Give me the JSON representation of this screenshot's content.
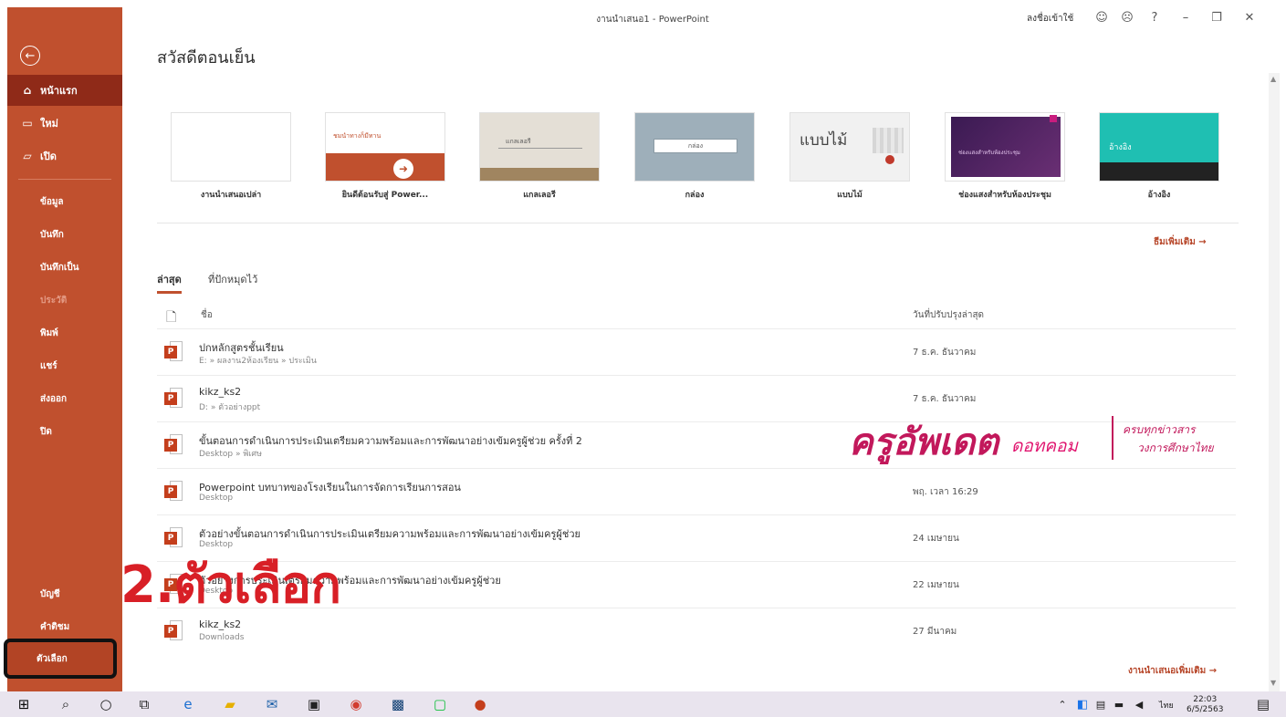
{
  "window": {
    "title": "งานนำเสนอ1 - PowerPoint",
    "signin_label": "ลงชื่อเข้าใช้"
  },
  "sidebar": {
    "back_icon": "back-arrow-icon",
    "items": [
      {
        "label": "หน้าแรก",
        "icon": "home-icon"
      },
      {
        "label": "ใหม่",
        "icon": "new-file-icon"
      },
      {
        "label": "เปิด",
        "icon": "open-folder-icon"
      }
    ],
    "sub_items": [
      "ข้อมูล",
      "บันทึก",
      "บันทึกเป็น",
      "ประวัติ",
      "พิมพ์",
      "แชร์",
      "ส่งออก",
      "ปิด"
    ],
    "bottom_items": [
      "บัญชี",
      "คำติชม",
      "ตัวเลือก"
    ]
  },
  "main": {
    "greeting": "สวัสดีตอนเย็น",
    "templates": [
      {
        "label": "งานนำเสนอเปล่า",
        "thumb_text": ""
      },
      {
        "label": "ยินดีต้อนรับสู่ Power...",
        "thumb_text": "ชมนำทางก็มีทาน"
      },
      {
        "label": "แกลเลอรี",
        "thumb_text": "แกลเลอรี"
      },
      {
        "label": "กล่อง",
        "thumb_text": "กล่อง"
      },
      {
        "label": "แบบไม้",
        "thumb_text": "แบบไม้"
      },
      {
        "label": "ช่องแสงสำหรับห้องประชุม",
        "thumb_text": "ช่องแสงสำหรับห้องประชุม"
      },
      {
        "label": "อ้างอิง",
        "thumb_text": "อ้างอิง"
      }
    ],
    "more_themes": "ธีมเพิ่มเติม →",
    "tabs": [
      "ล่าสุด",
      "ที่ปักหมุดไว้"
    ],
    "file_header": {
      "name": "ชื่อ",
      "date": "วันที่ปรับปรุงล่าสุด"
    },
    "files": [
      {
        "name": "ปกหลักสูตรชั้นเรียน",
        "path": "E: » ผลงาน2ห้องเรียน » ประเมิน",
        "date": "7 ธ.ค. ธันวาคม"
      },
      {
        "name": "kikz_ks2",
        "path": "D: » ตัวอย่างppt",
        "date": "7 ธ.ค. ธันวาคม"
      },
      {
        "name": "ขั้นตอนการดำเนินการประเมินเตรียมความพร้อมและการพัฒนาอย่างเข้มครูผู้ช่วย ครั้งที่ 2",
        "path": "Desktop » พิเศษ",
        "date": ""
      },
      {
        "name": "Powerpoint บทบาทของโรงเรียนในการจัดการเรียนการสอน",
        "path": "Desktop",
        "date": "พฤ. เวลา 16:29"
      },
      {
        "name": "ตัวอย่างขั้นตอนการดำเนินการประเมินเตรียมความพร้อมและการพัฒนาอย่างเข้มครูผู้ช่วย",
        "path": "Desktop",
        "date": "24 เมษายน"
      },
      {
        "name": "ตัวอย่างการประเมินเตรียมความพร้อมและการพัฒนาอย่างเข้มครูผู้ช่วย",
        "path": "Desktop",
        "date": "22 เมษายน"
      },
      {
        "name": "kikz_ks2",
        "path": "Downloads",
        "date": "27 มีนาคม"
      }
    ],
    "more_presentations": "งานนำเสนอเพิ่มเติม →"
  },
  "overlay": {
    "step_label": "2.ตัวเลือก",
    "watermark_main": "ครูอัพเดต",
    "watermark_sub": "ดอทคอม",
    "watermark_line1": "ครบทุกข่าวสาร",
    "watermark_line2": "วงการศึกษาไทย"
  },
  "taskbar": {
    "time": "22:03",
    "date": "6/5/2563",
    "language": "ไทย"
  },
  "colors": {
    "sidebar": "#c0502e",
    "sidebar_active": "#8f2a18",
    "accent": "#b7472a",
    "step_label": "#d81f26",
    "watermark": "#c2185b"
  }
}
